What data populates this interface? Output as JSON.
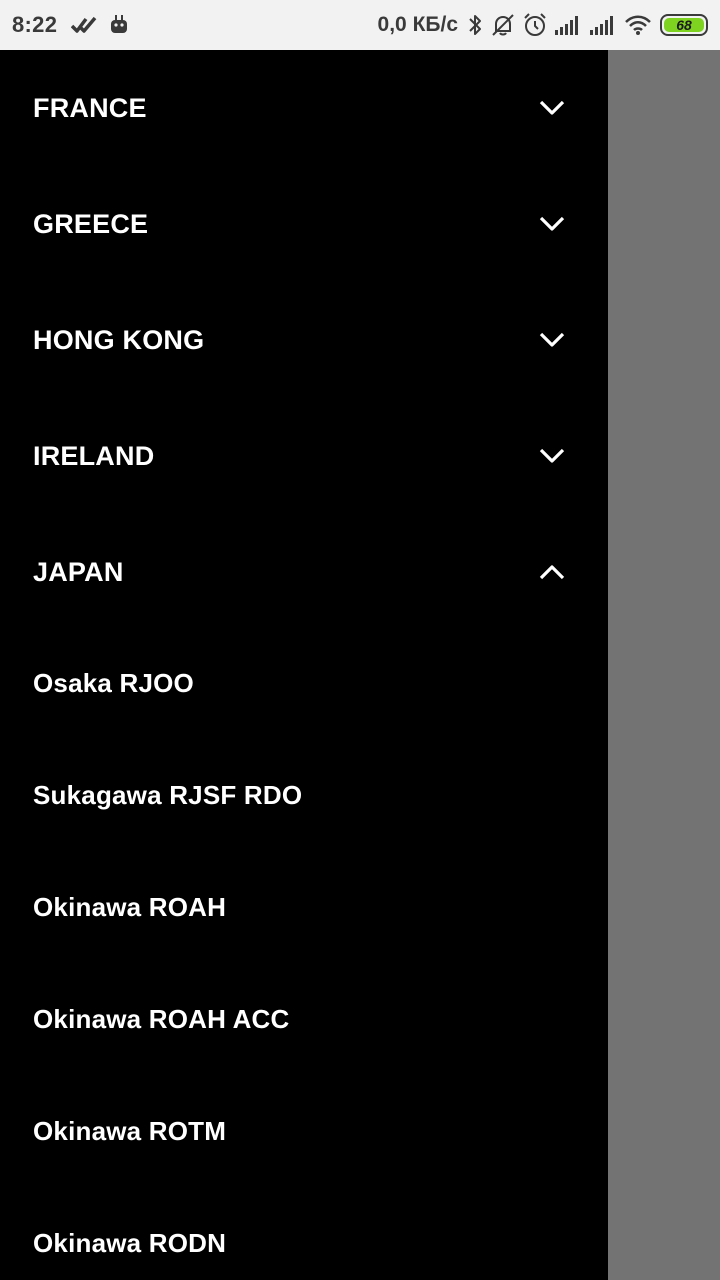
{
  "status_bar": {
    "time": "8:22",
    "speed": "0,0 КБ/с",
    "battery": "68",
    "icons": [
      "done-all-icon",
      "android-icon",
      "bluetooth-icon",
      "bell-off-icon",
      "alarm-icon",
      "signal-icon",
      "signal-icon",
      "wifi-icon",
      "battery-icon"
    ]
  },
  "drawer": {
    "countries": [
      {
        "label": "FRANCE",
        "expanded": false
      },
      {
        "label": "GREECE",
        "expanded": false
      },
      {
        "label": "HONG KONG",
        "expanded": false
      },
      {
        "label": "IRELAND",
        "expanded": false
      },
      {
        "label": "JAPAN",
        "expanded": true
      }
    ],
    "stations": [
      {
        "label": "Osaka RJOO"
      },
      {
        "label": "Sukagawa RJSF RDO"
      },
      {
        "label": "Okinawa ROAH"
      },
      {
        "label": "Okinawa ROAH ACC"
      },
      {
        "label": "Okinawa ROTM"
      },
      {
        "label": "Okinawa RODN"
      }
    ]
  },
  "colors": {
    "drawer_bg": "#000000",
    "scrim": "#737373",
    "status_bg": "#f2f2f2",
    "battery_fill": "#7ed321"
  }
}
